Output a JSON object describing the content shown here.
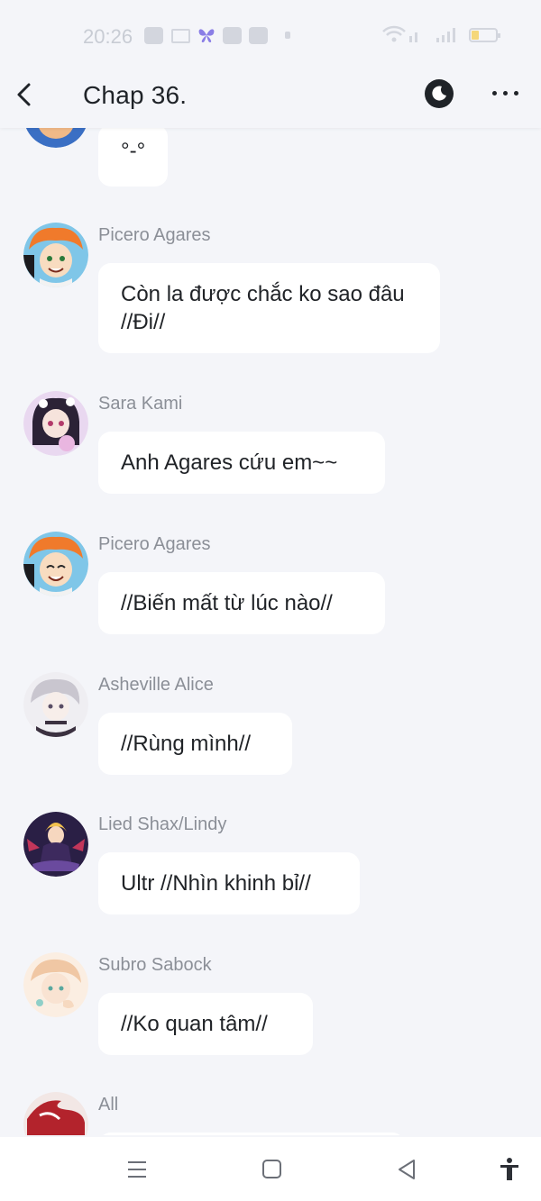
{
  "status_bar": {
    "time": "20:26",
    "icons": [
      "video-app-icon",
      "screen-icon",
      "butterfly-icon",
      "chat-app-icon",
      "app-icon",
      "dot-icon",
      "wifi-icon",
      "signal-icon",
      "battery-icon"
    ],
    "battery_color": "#f5d77a"
  },
  "header": {
    "title": "Chap 36.",
    "icons": [
      "back-icon",
      "moon-icon",
      "more-icon"
    ]
  },
  "messages": [
    {
      "sender": "",
      "text": "°-°",
      "avatar_colors": [
        "#3a6fc4",
        "#f0b987"
      ]
    },
    {
      "sender": "Picero Agares",
      "text": "Còn la được chắc ko sao đâu //Đi//",
      "avatar_colors": [
        "#f07a2b",
        "#7fc6e8"
      ]
    },
    {
      "sender": "Sara Kami",
      "text": "Anh Agares cứu em~~",
      "avatar_colors": [
        "#2b2236",
        "#e9b6e0"
      ]
    },
    {
      "sender": "Picero Agares",
      "text": "//Biến mất từ lúc nào//",
      "avatar_colors": [
        "#f07a2b",
        "#7fc6e8"
      ]
    },
    {
      "sender": "Asheville Alice",
      "text": "//Rùng mình//",
      "avatar_colors": [
        "#c9c6cf",
        "#3b3140"
      ]
    },
    {
      "sender": "Lied Shax/Lindy",
      "text": "Ultr //Nhìn khinh bỉ//",
      "avatar_colors": [
        "#3d2a5e",
        "#f2c14e"
      ]
    },
    {
      "sender": "Subro Sabock",
      "text": "//Ko quan tâm//",
      "avatar_colors": [
        "#f6d9c0",
        "#8fcfc8"
      ]
    },
    {
      "sender": "All",
      "text": "",
      "avatar_colors": [
        "#b3232c",
        "#f2e7e5"
      ]
    }
  ],
  "nav_bar": {
    "icons": [
      "menu-icon",
      "home-icon",
      "back-triangle-icon",
      "accessibility-icon"
    ]
  },
  "colors": {
    "background": "#f4f5f9",
    "bubble": "#ffffff",
    "sender": "#8b8f97",
    "text": "#202327"
  }
}
